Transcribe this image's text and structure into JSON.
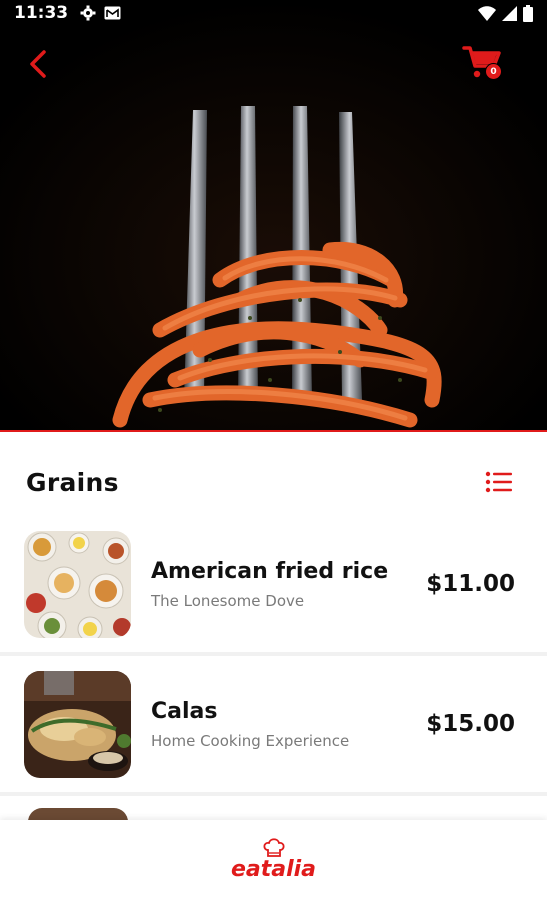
{
  "status_bar": {
    "time": "11:33"
  },
  "header": {
    "cart_count": "0"
  },
  "section": {
    "title": "Grains"
  },
  "items": [
    {
      "name": "American fried rice",
      "vendor": "The Lonesome Dove",
      "price": "$11.00"
    },
    {
      "name": "Calas",
      "vendor": "Home Cooking Experience",
      "price": "$15.00"
    }
  ],
  "brand": {
    "name": "eatalia"
  },
  "colors": {
    "accent": "#e01b1b",
    "hero_bg": "#000000",
    "text": "#111111",
    "muted": "#7a7a7a"
  },
  "icons": {
    "back": "chevron-left-icon",
    "cart": "cart-icon",
    "list": "list-icon",
    "settings": "gear-icon",
    "mail": "mail-icon",
    "wifi": "wifi-icon",
    "signal": "signal-icon",
    "battery": "battery-icon"
  }
}
